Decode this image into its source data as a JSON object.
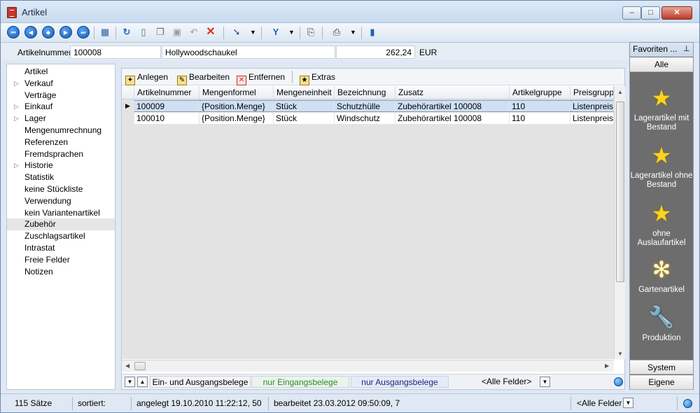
{
  "window": {
    "title": "Artikel",
    "minimize": "‒",
    "maximize": "□",
    "close": "✕"
  },
  "toolbar": {
    "icons": [
      "first-record-icon",
      "previous-record-icon",
      "add-record-icon",
      "next-record-icon",
      "last-record-icon",
      "table-view-icon",
      "refresh-icon",
      "new-document-icon",
      "copy-icon",
      "save-icon",
      "undo-icon",
      "delete-icon",
      "pointer-icon",
      "filter-icon",
      "report-icon",
      "print-icon",
      "book-icon"
    ]
  },
  "header": {
    "artikelnummer_label": "Artikelnummer",
    "artikelnummer": "100008",
    "bezeichnung": "Hollywoodschaukel",
    "preis": "262,24",
    "waehrung": "EUR"
  },
  "nav": {
    "items": [
      {
        "label": "Artikel",
        "expandable": false
      },
      {
        "label": "Verkauf",
        "expandable": true
      },
      {
        "label": "Verträge",
        "expandable": false
      },
      {
        "label": "Einkauf",
        "expandable": true
      },
      {
        "label": "Lager",
        "expandable": true
      },
      {
        "label": "Mengenumrechnung",
        "expandable": false
      },
      {
        "label": "Referenzen",
        "expandable": false
      },
      {
        "label": "Fremdsprachen",
        "expandable": false
      },
      {
        "label": "Historie",
        "expandable": true
      },
      {
        "label": "Statistik",
        "expandable": false
      },
      {
        "label": "keine Stückliste",
        "expandable": false
      },
      {
        "label": "Verwendung",
        "expandable": false
      },
      {
        "label": "kein Variantenartikel",
        "expandable": false
      },
      {
        "label": "Zubehör",
        "expandable": false,
        "selected": true
      },
      {
        "label": "Zuschlagsartikel",
        "expandable": false
      },
      {
        "label": "Intrastat",
        "expandable": false
      },
      {
        "label": "Freie Felder",
        "expandable": false
      },
      {
        "label": "Notizen",
        "expandable": false
      }
    ]
  },
  "grid_toolbar": {
    "anlegen": "Anlegen",
    "bearbeiten": "Bearbeiten",
    "entfernen": "Entfernen",
    "extras": "Extras"
  },
  "grid": {
    "columns": [
      "Artikelnummer",
      "Mengenformel",
      "Mengeneinheit",
      "Bezeichnung",
      "Zusatz",
      "Artikelgruppe",
      "Preisgruppe"
    ],
    "rows": [
      [
        "100009",
        "{Position.Menge}",
        "Stück",
        "Schutzhülle",
        "Zubehörartikel 100008",
        "110",
        "Listenpreis"
      ],
      [
        "100010",
        "{Position.Menge}",
        "Stück",
        "Windschutz",
        "Zubehörartikel 100008",
        "110",
        "Listenpreis"
      ]
    ]
  },
  "filter": {
    "all": "Ein- und Ausgangsbelege",
    "in": "nur Eingangsbelege",
    "out": "nur Ausgangsbelege",
    "fields": "<Alle Felder>",
    "in_color": "#2e8b2e",
    "out_color": "#1a237e"
  },
  "favorites": {
    "title": "Favoriten ...",
    "tab_all": "Alle",
    "items": [
      {
        "label": "Lagerartikel mit Bestand",
        "icon": "star-icon"
      },
      {
        "label": "Lagerartikel ohne Bestand",
        "icon": "star-icon"
      },
      {
        "label": "ohne Auslaufartikel",
        "icon": "star-icon"
      },
      {
        "label": "Gartenartikel",
        "icon": "flower-icon"
      },
      {
        "label": "Produktion",
        "icon": "wrench-icon"
      }
    ],
    "tab_system": "System",
    "tab_eigene": "Eigene"
  },
  "status": {
    "count": "115 Sätze",
    "sorted": "sortiert:",
    "created": "angelegt 19.10.2010 11:22:12, 50",
    "edited": "bearbeitet 23.03.2012 09:50:09,  7",
    "fields": "<Alle Felder>"
  }
}
